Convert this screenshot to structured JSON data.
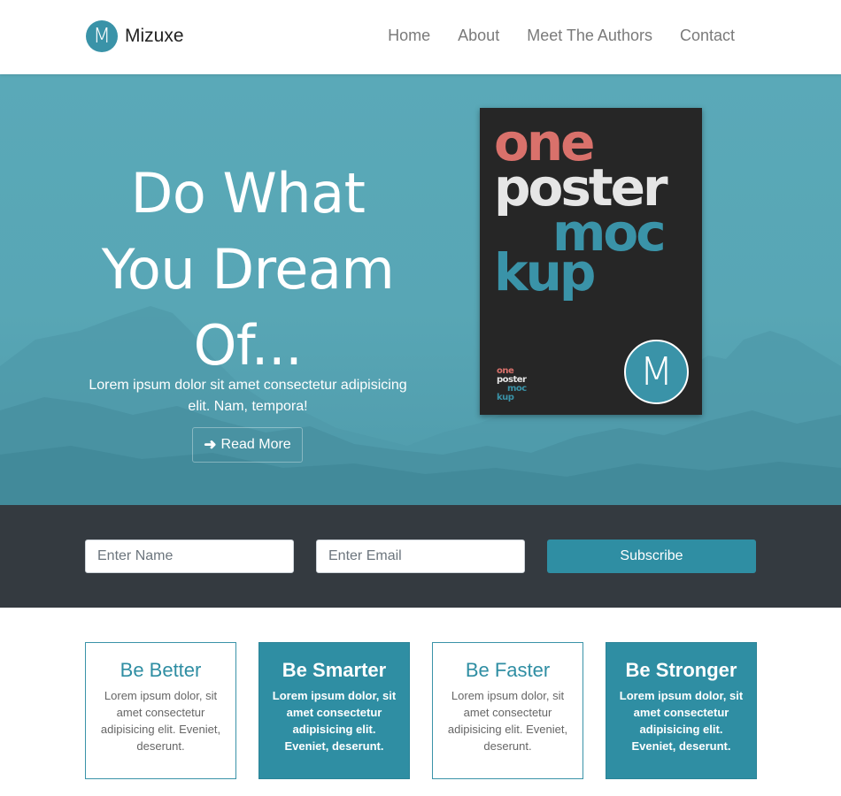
{
  "brand": {
    "logo_letter": "M",
    "name": "Mizuxe"
  },
  "nav": {
    "items": [
      "Home",
      "About",
      "Meet The Authors",
      "Contact"
    ]
  },
  "hero": {
    "title_lines": [
      "Do What",
      "You Dream",
      "Of..."
    ],
    "subtitle": "Lorem ipsum dolor sit amet consectetur adipisicing elit. Nam, tempora!",
    "button_label": "Read More",
    "button_icon": "arrow-right-icon"
  },
  "poster": {
    "lines": [
      "one",
      "poster",
      "moc",
      "kup"
    ],
    "mini_lines": [
      "one",
      "poster",
      "moc",
      "kup"
    ],
    "logo_letter": "M"
  },
  "subscribe": {
    "name_placeholder": "Enter Name",
    "email_placeholder": "Enter Email",
    "button_label": "Subscribe"
  },
  "features": [
    {
      "title": "Be Better",
      "text": "Lorem ipsum dolor, sit amet consectetur adipisicing elit. Eveniet, deserunt."
    },
    {
      "title": "Be Smarter",
      "text": "Lorem ipsum dolor, sit amet consectetur adipisicing elit. Eveniet, deserunt."
    },
    {
      "title": "Be Faster",
      "text": "Lorem ipsum dolor, sit amet consectetur adipisicing elit. Eveniet, deserunt."
    },
    {
      "title": "Be Stronger",
      "text": "Lorem ipsum dolor, sit amet consectetur adipisicing elit. Eveniet, deserunt."
    }
  ],
  "colors": {
    "primary": "#3a93a8",
    "dark": "#343a40",
    "hero": "#58a6b5",
    "poster_bg": "#262626",
    "poster_red": "#d9716b"
  }
}
